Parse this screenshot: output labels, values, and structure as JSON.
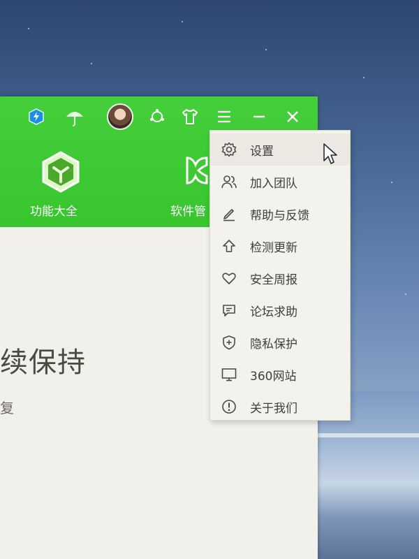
{
  "nav": {
    "items": [
      {
        "label": "功能大全",
        "icon": "cube-icon"
      },
      {
        "label": "软件管",
        "icon": "software-manager-icon"
      }
    ]
  },
  "window_controls": {
    "icons": [
      "lightning-shield-icon",
      "umbrella-icon",
      "avatar",
      "skin-icon",
      "shirt-icon",
      "menu-icon",
      "minimize-icon",
      "close-icon"
    ]
  },
  "content": {
    "heading_fragment": "续保持",
    "sub_fragment": "复"
  },
  "menu": {
    "items": [
      {
        "label": "设置",
        "icon": "gear-icon"
      },
      {
        "label": "加入团队",
        "icon": "team-icon"
      },
      {
        "label": "帮助与反馈",
        "icon": "pencil-icon"
      },
      {
        "label": "检测更新",
        "icon": "upload-arrow-icon"
      },
      {
        "label": "安全周报",
        "icon": "heart-icon"
      },
      {
        "label": "论坛求助",
        "icon": "chat-icon"
      },
      {
        "label": "隐私保护",
        "icon": "shield-plus-icon"
      },
      {
        "label": "360网站",
        "icon": "monitor-icon"
      },
      {
        "label": "关于我们",
        "icon": "info-icon"
      }
    ]
  },
  "colors": {
    "brand_green": "#3cc832",
    "menu_bg": "#f4f2ec",
    "text_dark": "#3f3e38"
  }
}
